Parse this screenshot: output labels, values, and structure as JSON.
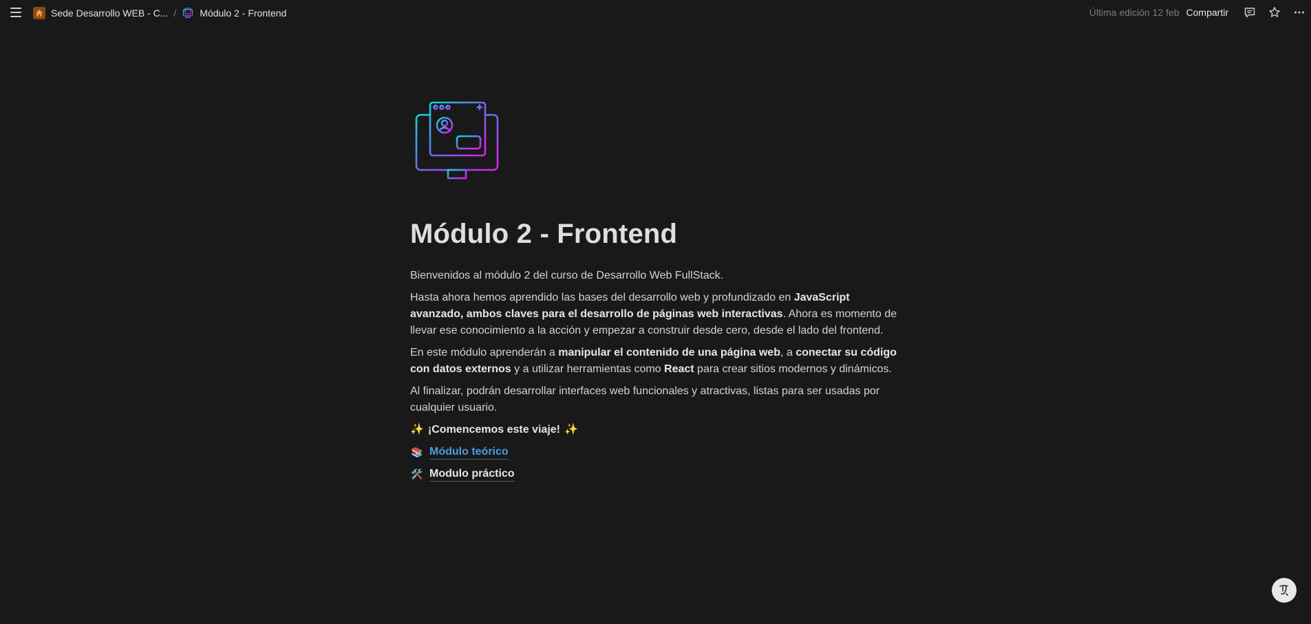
{
  "topbar": {
    "breadcrumbs": [
      {
        "label": "Sede Desarrollo WEB - C...",
        "icon": "home-icon"
      },
      {
        "label": "Módulo 2 - Frontend",
        "icon": "computer-icon"
      }
    ],
    "separator": "/",
    "last_edit": "Última edición 12 feb",
    "share_label": "Compartir"
  },
  "page": {
    "title": "Módulo 2 - Frontend",
    "intro": "Bienvenidos al módulo 2 del curso de Desarrollo Web FullStack.",
    "p2": {
      "pre": "Hasta ahora hemos aprendido las bases del desarrollo web y profundizado en ",
      "bold": "JavaScript avanzado, ambos claves para el desarrollo de páginas web interactivas",
      "post": ". Ahora es momento de llevar ese conocimiento a la acción y empezar a construir desde cero, desde el lado del frontend."
    },
    "p3": {
      "t1": "En este módulo aprenderán a ",
      "b1": "manipular el contenido de una página web",
      "t2": ", a ",
      "b2": "conectar su código con datos externos",
      "t3": " y a utilizar herramientas como ",
      "b3": "React",
      "t4": " para crear sitios modernos y dinámicos."
    },
    "p4": "Al finalizar, podrán desarrollar interfaces web funcionales y atractivas, listas para ser usadas por cualquier usuario.",
    "cta": "¡Comencemos este viaje!",
    "cta_emoji": "✨",
    "links": [
      {
        "emoji": "📚",
        "label": "Módulo teórico"
      },
      {
        "emoji": "🛠️",
        "label": "Modulo práctico"
      }
    ]
  },
  "colors": {
    "background": "#191919",
    "link_blue": "#4b9de3",
    "text": "#d4d4d4"
  }
}
